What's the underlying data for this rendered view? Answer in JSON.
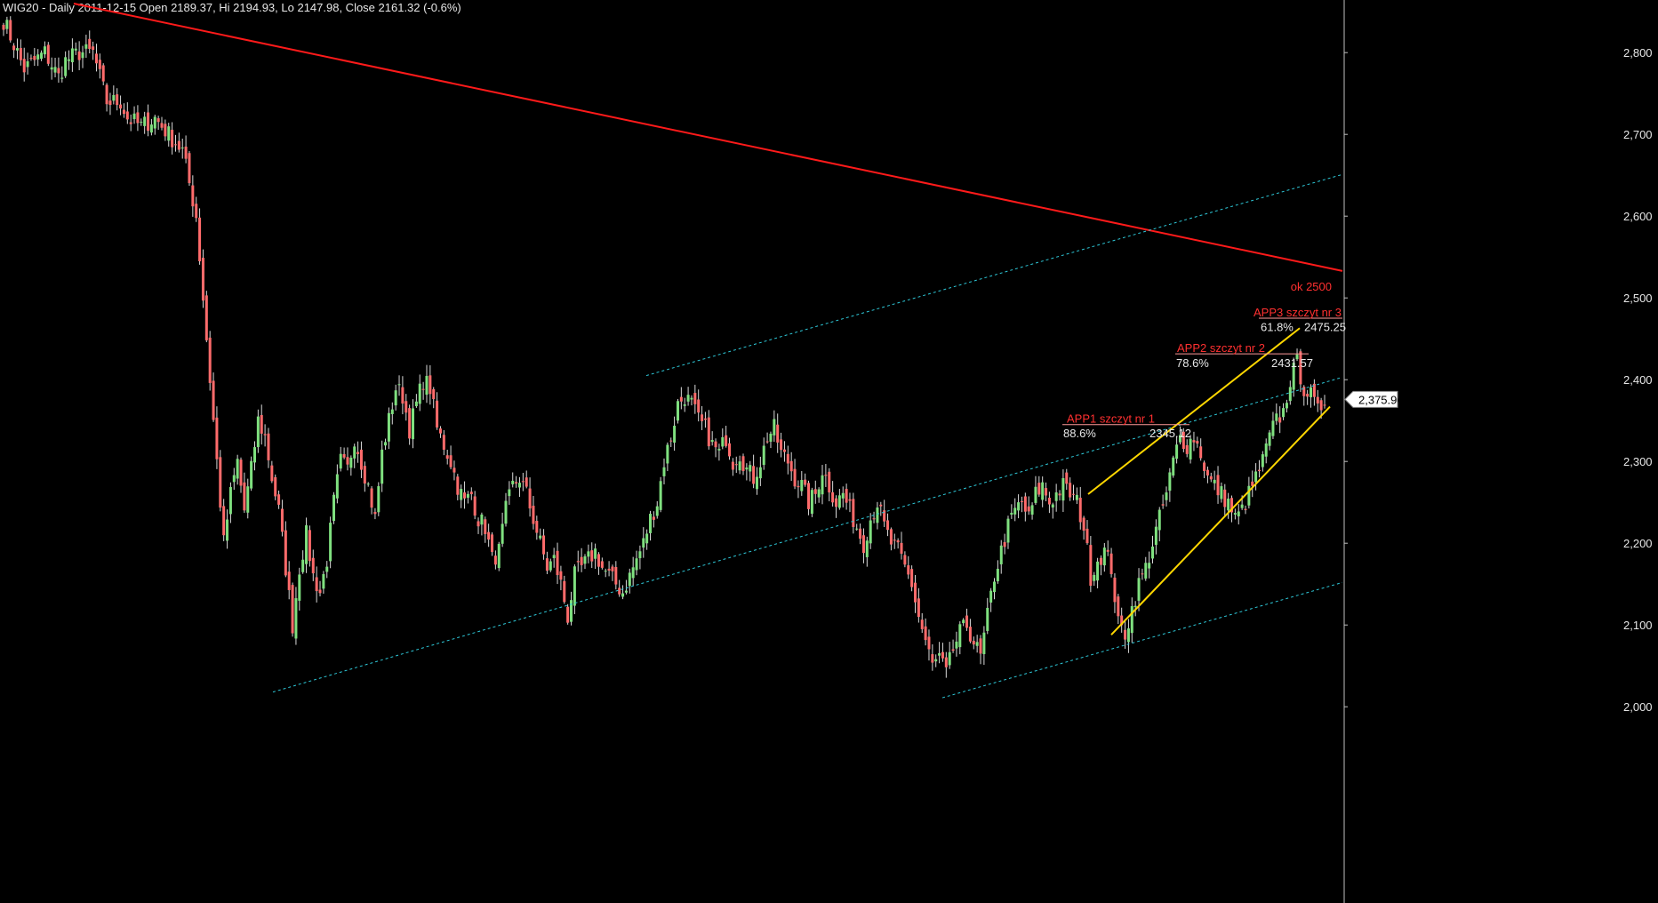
{
  "chart_data": {
    "type": "candlestick",
    "title": "WIG20 - Daily 2011-12-15 Open 2189.37, Hi 2194.93, Lo 2147.98, Close 2161.32 (-0.6%)",
    "ylim": [
      2000,
      2860
    ],
    "yticks": [
      {
        "value": 2000,
        "label": "2,000"
      },
      {
        "value": 2100,
        "label": "2,100"
      },
      {
        "value": 2200,
        "label": "2,200"
      },
      {
        "value": 2300,
        "label": "2,300"
      },
      {
        "value": 2400,
        "label": "2,400"
      },
      {
        "value": 2500,
        "label": "2,500"
      },
      {
        "value": 2600,
        "label": "2,600"
      },
      {
        "value": 2700,
        "label": "2,700"
      },
      {
        "value": 2800,
        "label": "2,800"
      }
    ],
    "last_price_label": "2,375.96",
    "last_price": 2375.96,
    "close_path": [
      [
        0,
        2840
      ],
      [
        6,
        2780
      ],
      [
        12,
        2800
      ],
      [
        16,
        2770
      ],
      [
        18,
        2790
      ],
      [
        22,
        2800
      ],
      [
        26,
        2800
      ],
      [
        30,
        2740
      ],
      [
        34,
        2740
      ],
      [
        36,
        2720
      ],
      [
        40,
        2710
      ],
      [
        44,
        2720
      ],
      [
        48,
        2700
      ],
      [
        52,
        2680
      ],
      [
        56,
        2600
      ],
      [
        58,
        2500
      ],
      [
        60,
        2400
      ],
      [
        62,
        2300
      ],
      [
        64,
        2200
      ],
      [
        66,
        2260
      ],
      [
        68,
        2300
      ],
      [
        70,
        2240
      ],
      [
        72,
        2290
      ],
      [
        74,
        2350
      ],
      [
        76,
        2330
      ],
      [
        78,
        2280
      ],
      [
        80,
        2240
      ],
      [
        82,
        2170
      ],
      [
        84,
        2100
      ],
      [
        86,
        2170
      ],
      [
        88,
        2210
      ],
      [
        90,
        2160
      ],
      [
        92,
        2140
      ],
      [
        94,
        2180
      ],
      [
        96,
        2250
      ],
      [
        98,
        2300
      ],
      [
        100,
        2290
      ],
      [
        102,
        2330
      ],
      [
        104,
        2300
      ],
      [
        106,
        2270
      ],
      [
        108,
        2230
      ],
      [
        110,
        2310
      ],
      [
        112,
        2350
      ],
      [
        114,
        2390
      ],
      [
        116,
        2380
      ],
      [
        118,
        2340
      ],
      [
        120,
        2370
      ],
      [
        122,
        2400
      ],
      [
        124,
        2390
      ],
      [
        126,
        2340
      ],
      [
        128,
        2320
      ],
      [
        130,
        2300
      ],
      [
        132,
        2270
      ],
      [
        134,
        2250
      ],
      [
        136,
        2260
      ],
      [
        138,
        2230
      ],
      [
        140,
        2220
      ],
      [
        142,
        2180
      ],
      [
        144,
        2190
      ],
      [
        146,
        2240
      ],
      [
        148,
        2270
      ],
      [
        150,
        2280
      ],
      [
        152,
        2260
      ],
      [
        154,
        2230
      ],
      [
        156,
        2200
      ],
      [
        158,
        2170
      ],
      [
        160,
        2180
      ],
      [
        162,
        2150
      ],
      [
        164,
        2110
      ],
      [
        166,
        2160
      ],
      [
        168,
        2170
      ],
      [
        170,
        2180
      ],
      [
        172,
        2190
      ],
      [
        174,
        2170
      ],
      [
        176,
        2160
      ],
      [
        178,
        2150
      ],
      [
        180,
        2140
      ],
      [
        182,
        2160
      ],
      [
        184,
        2180
      ],
      [
        186,
        2200
      ],
      [
        188,
        2230
      ],
      [
        190,
        2250
      ],
      [
        192,
        2300
      ],
      [
        194,
        2330
      ],
      [
        196,
        2370
      ],
      [
        198,
        2380
      ],
      [
        200,
        2370
      ],
      [
        202,
        2350
      ],
      [
        204,
        2340
      ],
      [
        206,
        2320
      ],
      [
        208,
        2310
      ],
      [
        210,
        2330
      ],
      [
        212,
        2300
      ],
      [
        214,
        2310
      ],
      [
        216,
        2290
      ],
      [
        218,
        2280
      ],
      [
        220,
        2300
      ],
      [
        222,
        2330
      ],
      [
        224,
        2340
      ],
      [
        226,
        2310
      ],
      [
        228,
        2300
      ],
      [
        230,
        2280
      ],
      [
        232,
        2270
      ],
      [
        234,
        2250
      ],
      [
        236,
        2260
      ],
      [
        238,
        2290
      ],
      [
        240,
        2270
      ],
      [
        242,
        2250
      ],
      [
        244,
        2260
      ],
      [
        246,
        2240
      ],
      [
        248,
        2220
      ],
      [
        250,
        2200
      ],
      [
        252,
        2230
      ],
      [
        254,
        2250
      ],
      [
        256,
        2220
      ],
      [
        258,
        2200
      ],
      [
        260,
        2190
      ],
      [
        262,
        2170
      ],
      [
        264,
        2150
      ],
      [
        266,
        2110
      ],
      [
        268,
        2080
      ],
      [
        270,
        2050
      ],
      [
        272,
        2060
      ],
      [
        274,
        2040
      ],
      [
        276,
        2070
      ],
      [
        278,
        2090
      ],
      [
        280,
        2100
      ],
      [
        282,
        2080
      ],
      [
        284,
        2060
      ],
      [
        286,
        2110
      ],
      [
        288,
        2160
      ],
      [
        290,
        2190
      ],
      [
        292,
        2220
      ],
      [
        294,
        2240
      ],
      [
        296,
        2250
      ],
      [
        298,
        2230
      ],
      [
        300,
        2260
      ],
      [
        302,
        2270
      ],
      [
        304,
        2250
      ],
      [
        306,
        2260
      ],
      [
        308,
        2270
      ],
      [
        310,
        2260
      ],
      [
        312,
        2250
      ],
      [
        314,
        2220
      ],
      [
        316,
        2160
      ],
      [
        318,
        2180
      ],
      [
        320,
        2190
      ],
      [
        322,
        2170
      ],
      [
        324,
        2100
      ],
      [
        326,
        2090
      ],
      [
        328,
        2120
      ],
      [
        330,
        2150
      ],
      [
        332,
        2170
      ],
      [
        334,
        2200
      ],
      [
        336,
        2230
      ],
      [
        338,
        2260
      ],
      [
        340,
        2300
      ],
      [
        342,
        2330
      ],
      [
        344,
        2320
      ],
      [
        346,
        2330
      ],
      [
        348,
        2310
      ],
      [
        350,
        2280
      ],
      [
        352,
        2270
      ],
      [
        354,
        2260
      ],
      [
        356,
        2250
      ],
      [
        358,
        2230
      ],
      [
        360,
        2240
      ],
      [
        362,
        2260
      ],
      [
        364,
        2280
      ],
      [
        366,
        2300
      ],
      [
        368,
        2330
      ],
      [
        370,
        2350
      ],
      [
        372,
        2360
      ],
      [
        374,
        2400
      ],
      [
        376,
        2420
      ],
      [
        378,
        2390
      ],
      [
        380,
        2380
      ],
      [
        382,
        2360
      ],
      [
        384,
        2376
      ]
    ],
    "lines": [
      {
        "name": "red-downtrend",
        "color": "#ff1a1a",
        "width": 2,
        "dash": false,
        "points": [
          [
            83,
            2860
          ],
          [
            1510,
            2533
          ]
        ]
      },
      {
        "name": "upper-channel",
        "color": "#2ec8d8",
        "width": 1,
        "dash": true,
        "points": [
          [
            727,
            2405
          ],
          [
            1510,
            2651
          ]
        ]
      },
      {
        "name": "middle-channel",
        "color": "#2ec8d8",
        "width": 1,
        "dash": true,
        "points": [
          [
            307,
            2018
          ],
          [
            1510,
            2403
          ]
        ]
      },
      {
        "name": "lower-channel",
        "color": "#2ec8d8",
        "width": 1,
        "dash": true,
        "points": [
          [
            1060,
            2011
          ],
          [
            1510,
            2152
          ]
        ]
      },
      {
        "name": "yellow-upper",
        "color": "#ffd700",
        "width": 2,
        "dash": false,
        "points": [
          [
            1224,
            2260
          ],
          [
            1462,
            2463
          ]
        ]
      },
      {
        "name": "yellow-lower",
        "color": "#ffd700",
        "width": 2,
        "dash": false,
        "points": [
          [
            1250,
            2088
          ],
          [
            1496,
            2367
          ]
        ]
      }
    ],
    "levels": [
      {
        "price": 2345.12,
        "x1": 1195,
        "x2": 1338,
        "color": "#ff9a9a"
      },
      {
        "price": 2431.57,
        "x1": 1322,
        "x2": 1472,
        "color": "#ff9a9a"
      },
      {
        "price": 2475.25,
        "x1": 1416,
        "x2": 1510,
        "color": "#ff9a9a"
      }
    ],
    "annotations": [
      {
        "text": "ok 2500",
        "x": 1498,
        "price": 2513,
        "color": "#ff3030",
        "anchor": "end"
      },
      {
        "text": "APP1 szczyt nr 1",
        "x": 1200,
        "price": 2352,
        "color": "#ff3030",
        "anchor": "start"
      },
      {
        "text": "88.6%",
        "x": 1196,
        "price": 2334,
        "color": "#e8e8e8",
        "anchor": "start"
      },
      {
        "text": "2345.12",
        "x": 1293,
        "price": 2334,
        "color": "#e8e8e8",
        "anchor": "start"
      },
      {
        "text": "APP2 szczyt nr 2",
        "x": 1324,
        "price": 2438,
        "color": "#ff3030",
        "anchor": "start"
      },
      {
        "text": "78.6%",
        "x": 1323,
        "price": 2420,
        "color": "#e8e8e8",
        "anchor": "start"
      },
      {
        "text": "2431.57",
        "x": 1430,
        "price": 2420,
        "color": "#e8e8e8",
        "anchor": "start"
      },
      {
        "text": "APP3 szczyt nr 3",
        "x": 1410,
        "price": 2482,
        "color": "#ff3030",
        "anchor": "start"
      },
      {
        "text": "61.8%",
        "x": 1418,
        "price": 2464,
        "color": "#e8e8e8",
        "anchor": "start"
      },
      {
        "text": "2475.25",
        "x": 1467,
        "price": 2464,
        "color": "#e8e8e8",
        "anchor": "start"
      }
    ]
  },
  "colors": {
    "background": "#000000",
    "bull_candle": "#7fe07f",
    "bear_candle": "#ff6b6b",
    "axis_text": "#e6e6e6",
    "axis_line": "#bfbfbf"
  }
}
